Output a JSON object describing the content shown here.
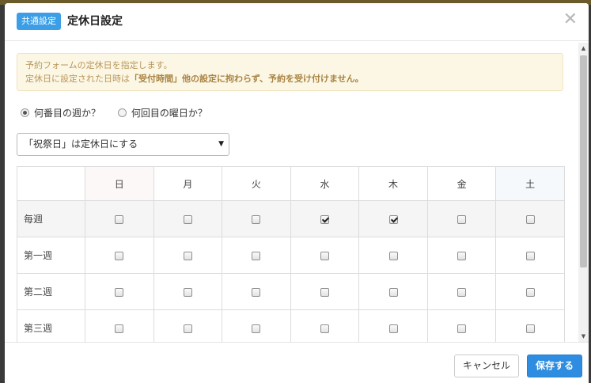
{
  "header": {
    "badge": "共通設定",
    "title": "定休日設定",
    "close_icon": "close-icon"
  },
  "notice": {
    "line1": "予約フォームの定休日を指定します。",
    "line2_prefix": "定休日に設定された日時は",
    "line2_bold": "「受付時間」他の設定に拘わらず、予約を受け付けません。"
  },
  "mode_options": [
    {
      "label": "何番目の週か？",
      "selected": true
    },
    {
      "label": "何回目の曜日か？",
      "selected": false
    }
  ],
  "holiday_select": {
    "value": "「祝祭日」は定休日にする"
  },
  "table": {
    "days": [
      "日",
      "月",
      "火",
      "水",
      "木",
      "金",
      "土"
    ],
    "rows": [
      {
        "label": "毎週",
        "checked": [
          false,
          false,
          false,
          true,
          true,
          false,
          false
        ]
      },
      {
        "label": "第一週",
        "checked": [
          false,
          false,
          false,
          false,
          false,
          false,
          false
        ]
      },
      {
        "label": "第二週",
        "checked": [
          false,
          false,
          false,
          false,
          false,
          false,
          false
        ]
      },
      {
        "label": "第三週",
        "checked": [
          false,
          false,
          false,
          false,
          false,
          false,
          false
        ]
      },
      {
        "label": "",
        "checked": [
          false,
          false,
          false,
          false,
          false,
          false,
          false
        ]
      }
    ]
  },
  "footer": {
    "cancel_label": "キャンセル",
    "save_label": "保存する"
  },
  "colors": {
    "badge": "#3b9ee6",
    "save_button": "#2e8de0",
    "notice_bg": "#fcf7e4",
    "notice_text": "#b8965c"
  }
}
